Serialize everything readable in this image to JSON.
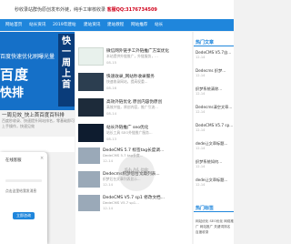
{
  "topbar": {
    "tagline": "秒收录站群伪原创发布外链，纯手工审核收录",
    "contact": "客服QQ:3176734509"
  },
  "nav": {
    "items": [
      "网站首页",
      "站长资讯",
      "2019年建站",
      "建站资讯",
      "建站教程",
      "网站推荐",
      "站长"
    ]
  },
  "banner": {
    "line1": "百度快速优化刷曝光量",
    "big1": "百度",
    "big2": "快排",
    "side": "快一周上首",
    "title": "一周见效_快上首百度百科排",
    "desc": "百度秒收录、快速提升网站排名，零基础即可上手操作，快速见效"
  },
  "list": [
    {
      "title": "微信网外链手工外链推广方案优化",
      "desc": "本站提供外链推广，外链服务，...",
      "date": "08-15"
    },
    {
      "title": "快速收录_网站秒收录服务",
      "desc": "快速收录网站，提高权重...",
      "date": "08-16"
    },
    {
      "title": "高效外链优化 原创内容伪原创",
      "desc": "高效外链，原创内容，推广引流...",
      "date": "08-14"
    },
    {
      "title": "站长外链推广 seo优化",
      "desc": "站长工具 SEO外链推广服务...",
      "date": "08-13"
    }
  ],
  "list2": [
    {
      "title": "DedeCMS 5.7 标签tag长度调...",
      "desc": "DedeCMS 5.7 tag长度...",
      "date": "12-14"
    },
    {
      "title": "Dedecms织梦后台文章列表...",
      "desc": "织梦后台文章列表显示...",
      "date": "12-14"
    },
    {
      "title": "DedeCMS V5.7 sp1 修改文档...",
      "desc": "DedeCMS V5.7 sp1...",
      "date": "12-14"
    }
  ],
  "sidebar": {
    "head1": "热门文章",
    "items1": [
      {
        "title": "DedeCMS V5.7自...",
        "date": "12-14"
      },
      {
        "title": "Dedecms 织梦...",
        "date": "12-14"
      },
      {
        "title": "织梦系统清除...",
        "date": "12-14"
      },
      {
        "title": "Dedecms清空文章...",
        "date": "12-14"
      },
      {
        "title": "DedeCMS V5.7 sp...",
        "date": "12-14"
      },
      {
        "title": "dede让文章标题...",
        "date": "12-14"
      },
      {
        "title": "织梦系统如何...",
        "date": "12-14"
      },
      {
        "title": "dede让文章标题...",
        "date": "12-14"
      }
    ],
    "head2": "热门标签",
    "tags": "网站优化 SEO优化 网络推广 网站推广 关键词排名 百度收录"
  },
  "modal": {
    "title": "在线客服",
    "close": "×",
    "text": "点击这里给我发消息",
    "button": "立即咨询"
  },
  "watermark": "秒外链"
}
